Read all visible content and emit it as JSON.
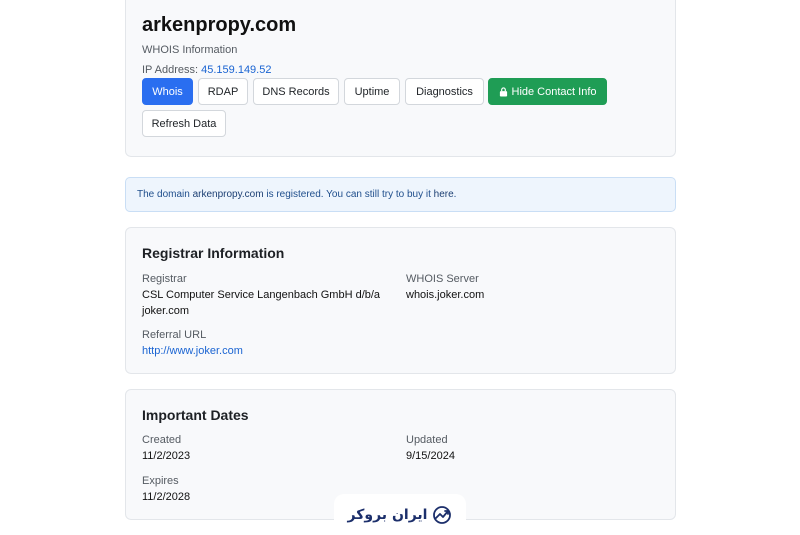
{
  "header": {
    "domain": "arkenpropy.com",
    "subtitle": "WHOIS Information",
    "ip_label": "IP Address:",
    "ip_value": "45.159.149.52",
    "buttons": {
      "whois": "Whois",
      "rdap": "RDAP",
      "dns": "DNS Records",
      "uptime": "Uptime",
      "diagnostics": "Diagnostics",
      "hide_contact": "Hide Contact Info",
      "refresh": "Refresh Data"
    },
    "colors": {
      "primary": "#2a6ef0",
      "success": "#1f9d55",
      "link": "#1a64d2"
    }
  },
  "alert": {
    "prefix": "The domain ",
    "domain": "arkenpropy.com",
    "middle": " is registered. You can still try to buy it ",
    "link": "here",
    "suffix": "."
  },
  "registrar": {
    "title": "Registrar Information",
    "registrar_label": "Registrar",
    "registrar_line1": "CSL Computer Service Langenbach GmbH d/b/a",
    "registrar_line2": "joker.com",
    "whois_server_label": "WHOIS Server",
    "whois_server_value": "whois.joker.com",
    "referral_label": "Referral URL",
    "referral_value": "http://www.joker.com"
  },
  "dates": {
    "title": "Important Dates",
    "created_label": "Created",
    "created_value": "11/2/2023",
    "updated_label": "Updated",
    "updated_value": "9/15/2024",
    "expires_label": "Expires",
    "expires_value": "11/2/2028"
  },
  "watermark": {
    "text": "ایران بروکر",
    "icon": "chart-trend-logo-icon"
  }
}
